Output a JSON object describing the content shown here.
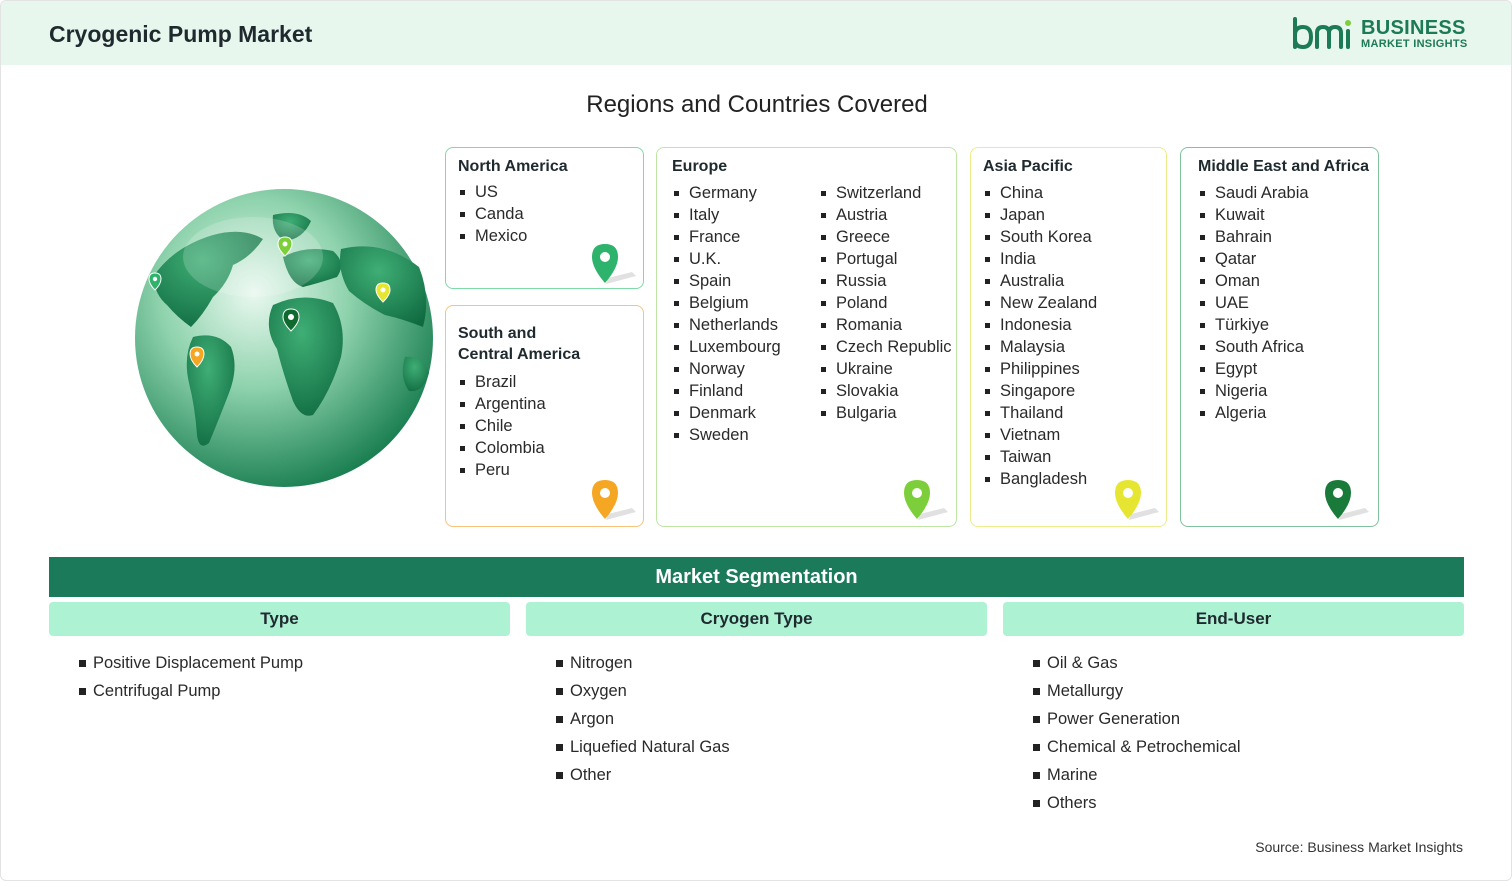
{
  "header": {
    "title": "Cryogenic Pump Market",
    "logo_word1": "BUSINESS",
    "logo_word2": "MARKET INSIGHTS",
    "logo_mark": "bmi",
    "brand_color": "#1d7a57"
  },
  "regions": {
    "title": "Regions and Countries Covered",
    "globe_icon": "globe-with-pins",
    "north_america": {
      "name": "North America",
      "color": "#2db36b",
      "countries": [
        "US",
        "Canda",
        "Mexico"
      ]
    },
    "south_central_america": {
      "name_line1": "South and",
      "name_line2": "Central America",
      "color": "#f5a623",
      "countries": [
        "Brazil",
        "Argentina",
        "Chile",
        "Colombia",
        "Peru"
      ]
    },
    "europe": {
      "name": "Europe",
      "color": "#7ccf3a",
      "col1": [
        "Germany",
        "Italy",
        "France",
        "U.K.",
        "Spain",
        "Belgium",
        "Netherlands",
        "Luxembourg",
        "Norway",
        "Finland",
        "Denmark",
        "Sweden"
      ],
      "col2": [
        "Switzerland",
        "Austria",
        "Greece",
        "Portugal",
        "Russia",
        "Poland",
        "Romania",
        "Czech Republic",
        "Ukraine",
        "Slovakia",
        "Bulgaria"
      ]
    },
    "asia_pacific": {
      "name": "Asia Pacific",
      "color": "#e6e632",
      "countries": [
        "China",
        "Japan",
        "South Korea",
        "India",
        "Australia",
        "New Zealand",
        "Indonesia",
        "Malaysia",
        "Philippines",
        "Singapore",
        "Thailand",
        "Vietnam",
        "Taiwan",
        "Bangladesh"
      ]
    },
    "middle_east_africa": {
      "name": "Middle East and Africa",
      "color": "#1a7a3a",
      "countries": [
        "Saudi Arabia",
        "Kuwait",
        "Bahrain",
        "Qatar",
        "Oman",
        "UAE",
        "Türkiye",
        "South Africa",
        "Egypt",
        "Nigeria",
        "Algeria"
      ]
    }
  },
  "segmentation": {
    "title": "Market Segmentation",
    "type": {
      "header": "Type",
      "items": [
        "Positive Displacement Pump",
        "Centrifugal Pump"
      ]
    },
    "cryogen_type": {
      "header": "Cryogen Type",
      "items": [
        "Nitrogen",
        "Oxygen",
        "Argon",
        "Liquefied Natural Gas",
        "Other"
      ]
    },
    "end_user": {
      "header": "End-User",
      "items": [
        "Oil & Gas",
        "Metallurgy",
        "Power Generation",
        "Chemical & Petrochemical",
        "Marine",
        "Others"
      ]
    }
  },
  "source": "Source: Business Market Insights"
}
